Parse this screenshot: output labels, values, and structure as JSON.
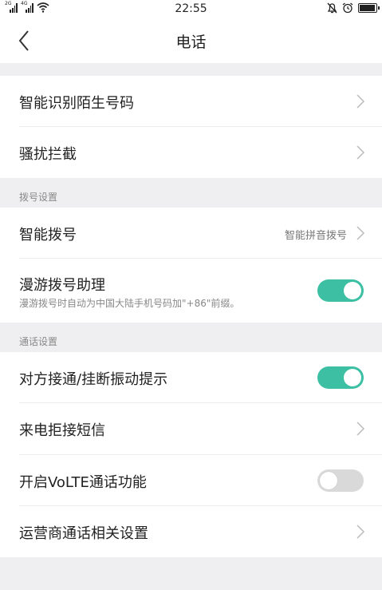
{
  "status_bar": {
    "sim1_tag": "2G",
    "sim2_tag": "4G",
    "time": "22:55"
  },
  "header": {
    "title": "电话"
  },
  "rows": {
    "smart_identify": {
      "label": "智能识别陌生号码"
    },
    "harassment_block": {
      "label": "骚扰拦截"
    },
    "smart_dial": {
      "label": "智能拨号",
      "value": "智能拼音拨号"
    },
    "roaming_assistant": {
      "label": "漫游拨号助理",
      "sub": "漫游拨号时自动为中国大陆手机号码加\"+86\"前缀。",
      "on": true
    },
    "vibrate_on_connect": {
      "label": "对方接通/挂断振动提示",
      "on": true
    },
    "reject_sms": {
      "label": "来电拒接短信"
    },
    "volte": {
      "label": "开启VoLTE通话功能",
      "on": false
    },
    "carrier_settings": {
      "label": "运营商通话相关设置"
    }
  },
  "sections": {
    "dial_settings": "拨号设置",
    "call_settings": "通话设置"
  },
  "colors": {
    "accent": "#3dbfa3",
    "toggle_off": "#d9d9d9",
    "background": "#efeff1"
  }
}
